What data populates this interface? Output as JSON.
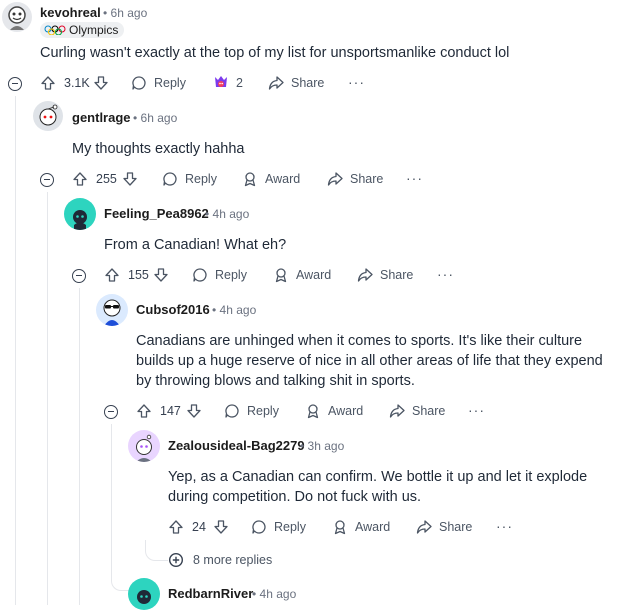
{
  "comments": [
    {
      "author": "kevohreal",
      "time": "6h ago",
      "flair": "Olympics",
      "text": "Curling wasn't exactly at the top of my list for unsportsmanlike conduct lol",
      "votes": "3.1K",
      "reply": "Reply",
      "award_count": "2",
      "share": "Share"
    },
    {
      "author": "gentlrage",
      "time": "6h ago",
      "text": "My thoughts exactly hahha",
      "votes": "255",
      "reply": "Reply",
      "award": "Award",
      "share": "Share"
    },
    {
      "author": "Feeling_Pea8962",
      "time": "4h ago",
      "text": "From a Canadian! What eh?",
      "votes": "155",
      "reply": "Reply",
      "award": "Award",
      "share": "Share"
    },
    {
      "author": "Cubsof2016",
      "time": "4h ago",
      "text": "Canadians are unhinged when it comes to sports. It's like their culture builds up a huge reserve of nice in all other areas of life that they expend by throwing blows and talking shit in sports.",
      "votes": "147",
      "reply": "Reply",
      "award": "Award",
      "share": "Share"
    },
    {
      "author": "Zealousideal-Bag2279",
      "time": "3h ago",
      "text": "Yep, as a Canadian can confirm. We bottle it up and let it explode during competition. Do not fuck with us.",
      "votes": "24",
      "reply": "Reply",
      "award": "Award",
      "share": "Share"
    },
    {
      "author": "RedbarnRiver",
      "time": "4h ago"
    }
  ],
  "more_replies": "8 more replies",
  "dot": "•",
  "overflow": "···",
  "icons": {
    "upvote": "arrow-up-icon",
    "downvote": "arrow-down-icon",
    "reply": "speech-bubble-icon",
    "award": "award-icon",
    "share": "share-arrow-icon",
    "collapse": "minus-circle-icon",
    "expand": "plus-circle-icon"
  }
}
